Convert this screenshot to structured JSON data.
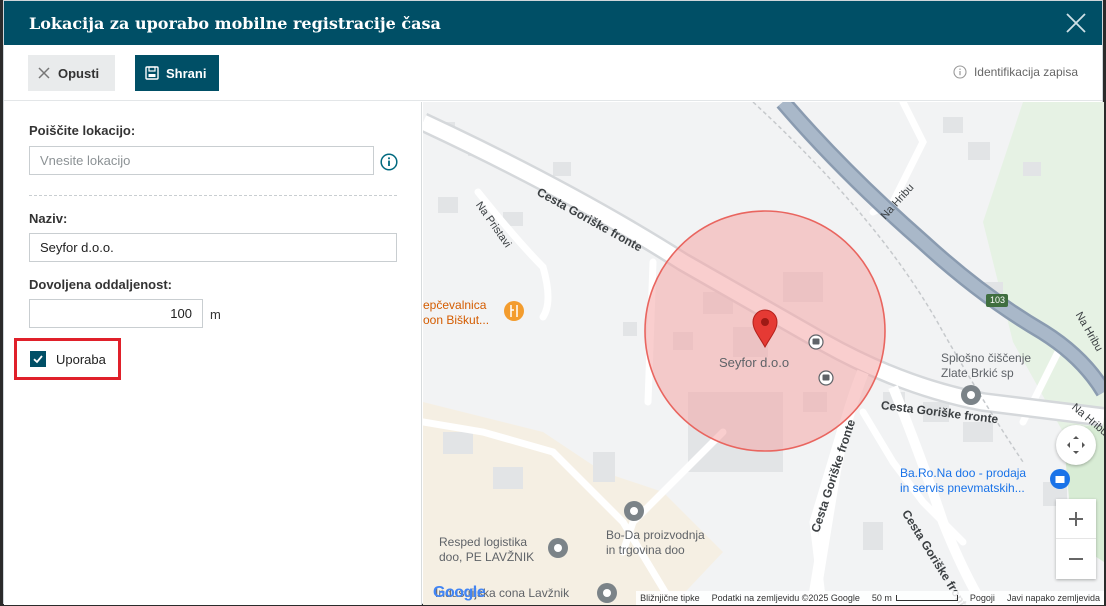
{
  "modal": {
    "title": "Lokacija za uporabo mobilne registracije časa"
  },
  "toolbar": {
    "cancel_label": "Opusti",
    "save_label": "Shrani",
    "ident_label": "Identifikacija zapisa"
  },
  "form": {
    "search_label": "Poiščite lokacijo:",
    "search_placeholder": "Vnesite lokacijo",
    "name_label": "Naziv:",
    "name_value": "Seyfor d.o.o.",
    "distance_label": "Dovoljena oddaljenost:",
    "distance_value": "100",
    "distance_unit": "m",
    "usage_label": "Uporaba",
    "usage_checked": true
  },
  "map": {
    "road_gorisko_1": "Cesta Goriške fronte",
    "road_gorisko_2": "Cesta Goriške fronte",
    "road_gorisko_3": "Cesta Goriške fronte",
    "road_gorisko_4": "Cesta Goriške fronte",
    "road_na_pristavi": "Na Pristavi",
    "road_na_hribu_1": "Na Hribu",
    "road_na_hribu_2": "Na Hribu",
    "road_na_hribu_3": "Na Hribu",
    "road_number": "103",
    "place_seyfor": "Seyfor d.o.o",
    "place_cleaning": "Splošno čiščenje\nZlate Brkić sp",
    "place_bar": "Ba.Ro.Na doo - prodaja\nin servis pnevmatskih...",
    "place_bakery": "epčevalnica\noon Biškut...",
    "place_resped": "Resped logistika\ndoo, PE LAVŽNIK",
    "place_boda": "Bo-Da proizvodnja\nin trgovina doo",
    "place_industry": "Industrijska cona Lavžnik",
    "google": "Google",
    "attrib_keys": "Bližnjične tipke",
    "attrib_data": "Podatki na zemljevidu ©2025 Google",
    "attrib_scale": "50 m",
    "attrib_terms": "Pogoji",
    "attrib_report": "Javi napako zemljevida"
  },
  "colors": {
    "brand": "#004f66",
    "radius_fill": "#f4a5a5",
    "highlight": "#e0202a"
  }
}
